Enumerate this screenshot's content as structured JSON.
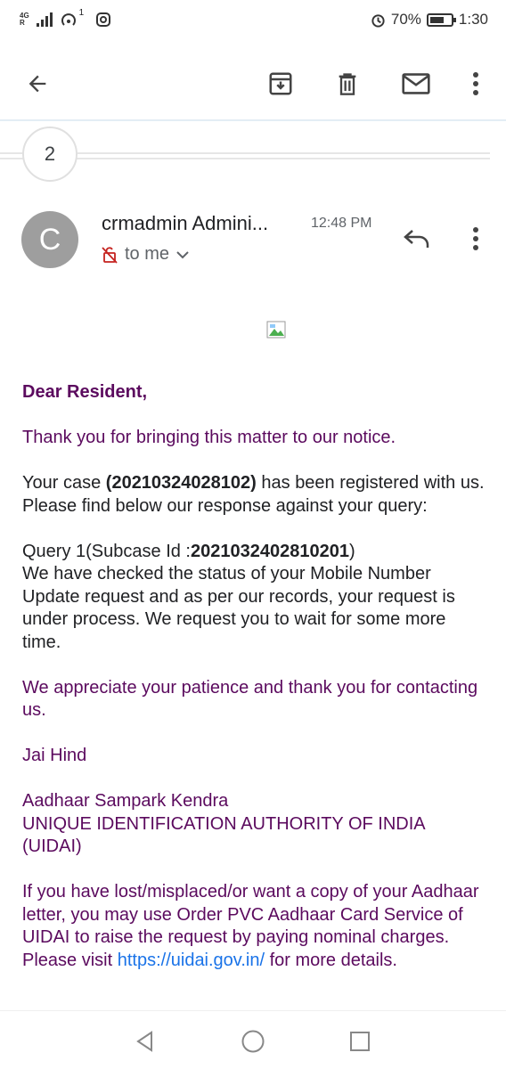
{
  "status_bar": {
    "network_top": "4G",
    "network_bottom": "R",
    "notification_count": "1",
    "battery_percent": "70%",
    "battery_level": 0.7,
    "time": "1:30"
  },
  "toolbar": {
    "icons": [
      "back-arrow-icon",
      "archive-icon",
      "delete-icon",
      "mark-unread-icon",
      "more-vert-icon"
    ]
  },
  "thread": {
    "collapsed_count": "2"
  },
  "message": {
    "avatar_letter": "C",
    "avatar_color": "#9e9e9e",
    "sender": "crmadmin Admini...",
    "time": "12:48 PM",
    "recipient": "to me"
  },
  "body": {
    "greeting": "Dear Resident,",
    "thanks": "Thank you for bringing this matter to our notice.",
    "case_prefix": "Your case ",
    "case_id": "(20210324028102)",
    "case_suffix": " has been registered with us. Please find below our response against your query:",
    "query_prefix": "Query 1(Subcase Id :",
    "subcase_id": "2021032402810201",
    "query_suffix": ")",
    "query_response": "We have checked the status of your Mobile Number Update request and as per our records, your request is under process. We request you to wait for some more time.",
    "appreciate": "We appreciate your patience and thank you for contacting us.",
    "sign_off": "Jai Hind",
    "org_line1": "Aadhaar Sampark Kendra",
    "org_line2": "UNIQUE IDENTIFICATION AUTHORITY OF INDIA (UIDAI)",
    "pvc_text": "If you have lost/misplaced/or want a copy of your Aadhaar letter, you may use Order PVC Aadhaar Card Service of UIDAI to raise the request by paying nominal charges. Please visit ",
    "pvc_link": "https://uidai.gov.in/",
    "pvc_suffix": " for more details."
  },
  "colors": {
    "accent_purple": "#5b0a5e",
    "link_blue": "#1a73e8"
  }
}
